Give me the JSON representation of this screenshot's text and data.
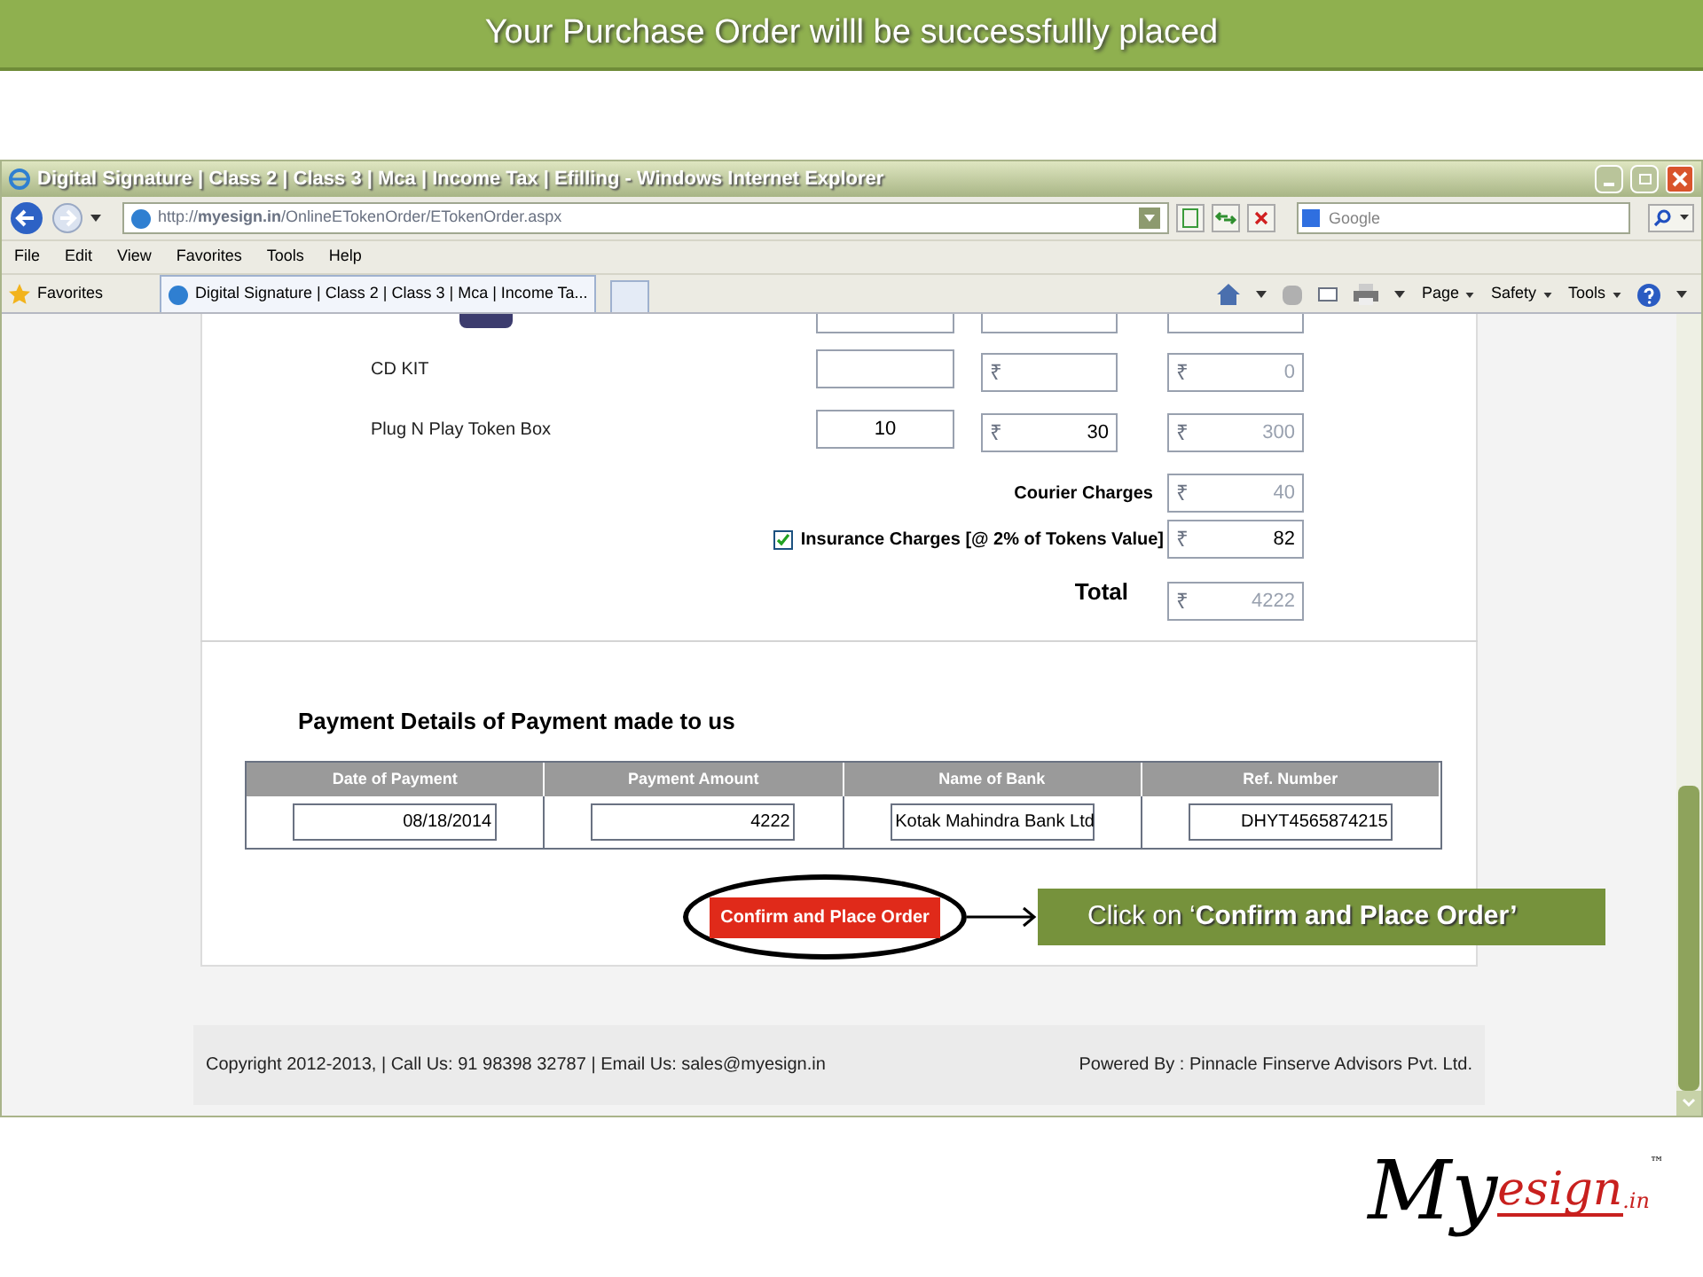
{
  "slide_banner": "Your Purchase Order willl be successfullly placed",
  "browser": {
    "title": "Digital Signature | Class 2 | Class 3 | Mca | Income Tax | Efilling - Windows Internet Explorer",
    "address": "http://**myesign.in**/OnlineETokenOrder/ETokenOrder.aspx",
    "search_placeholder": "Google",
    "menu": [
      "File",
      "Edit",
      "View",
      "Favorites",
      "Tools",
      "Help"
    ],
    "favorites": "Favorites",
    "tab": "Digital Signature | Class 2 | Class 3 | Mca | Income Ta...",
    "commands": [
      "Page",
      "Safety",
      "Tools"
    ]
  },
  "products": [
    {
      "label": "CD KIT",
      "price": {
        "currency": "₹"
      },
      "amount": {
        "currency": "₹",
        "value": "0"
      }
    },
    {
      "label": "Plug N Play Token Box",
      "qty": "10",
      "price": {
        "currency": "₹",
        "value": "30"
      },
      "amount": {
        "currency": "₹",
        "value": "300"
      }
    }
  ],
  "courier": {
    "label": "Courier Charges",
    "currency": "₹",
    "value": "40"
  },
  "insurance": {
    "label": "Insurance Charges [@ 2% of Tokens Value]",
    "checked": true,
    "currency": "₹",
    "value": "82"
  },
  "total": {
    "label": "Total",
    "currency": "₹",
    "value": "4222"
  },
  "payment": {
    "heading": "Payment Details of Payment made to us",
    "columns": [
      "Date of Payment",
      "Payment Amount",
      "Name of Bank",
      "Ref. Number"
    ],
    "values": [
      "08/18/2014",
      "4222",
      "Kotak Mahindra Bank Ltd",
      "DHYT4565874215"
    ]
  },
  "confirm_button": "Confirm and Place Order",
  "callout": "Click on ‘**Confirm and Place Order’**",
  "footer": {
    "left": "Copyright 2012-2013, | Call Us: 91 98398 32787 | Email Us: sales@myesign.in",
    "right": "Powered By : Pinnacle Finserve Advisors Pvt. Ltd."
  },
  "logo": {
    "my": "My",
    "esign": "esign",
    "domain": ".in",
    "tm": "™"
  }
}
